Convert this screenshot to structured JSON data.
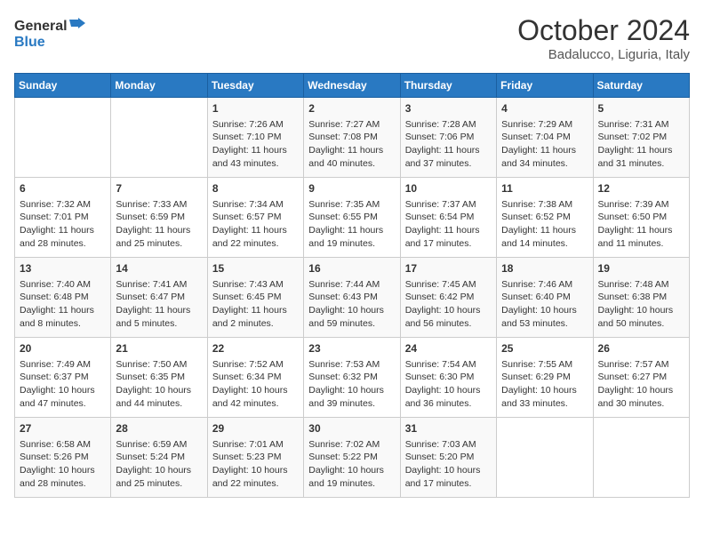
{
  "header": {
    "logo_line1": "General",
    "logo_line2": "Blue",
    "month": "October 2024",
    "location": "Badalucco, Liguria, Italy"
  },
  "days_of_week": [
    "Sunday",
    "Monday",
    "Tuesday",
    "Wednesday",
    "Thursday",
    "Friday",
    "Saturday"
  ],
  "weeks": [
    [
      {
        "day": "",
        "sunrise": "",
        "sunset": "",
        "daylight": ""
      },
      {
        "day": "",
        "sunrise": "",
        "sunset": "",
        "daylight": ""
      },
      {
        "day": "1",
        "sunrise": "Sunrise: 7:26 AM",
        "sunset": "Sunset: 7:10 PM",
        "daylight": "Daylight: 11 hours and 43 minutes."
      },
      {
        "day": "2",
        "sunrise": "Sunrise: 7:27 AM",
        "sunset": "Sunset: 7:08 PM",
        "daylight": "Daylight: 11 hours and 40 minutes."
      },
      {
        "day": "3",
        "sunrise": "Sunrise: 7:28 AM",
        "sunset": "Sunset: 7:06 PM",
        "daylight": "Daylight: 11 hours and 37 minutes."
      },
      {
        "day": "4",
        "sunrise": "Sunrise: 7:29 AM",
        "sunset": "Sunset: 7:04 PM",
        "daylight": "Daylight: 11 hours and 34 minutes."
      },
      {
        "day": "5",
        "sunrise": "Sunrise: 7:31 AM",
        "sunset": "Sunset: 7:02 PM",
        "daylight": "Daylight: 11 hours and 31 minutes."
      }
    ],
    [
      {
        "day": "6",
        "sunrise": "Sunrise: 7:32 AM",
        "sunset": "Sunset: 7:01 PM",
        "daylight": "Daylight: 11 hours and 28 minutes."
      },
      {
        "day": "7",
        "sunrise": "Sunrise: 7:33 AM",
        "sunset": "Sunset: 6:59 PM",
        "daylight": "Daylight: 11 hours and 25 minutes."
      },
      {
        "day": "8",
        "sunrise": "Sunrise: 7:34 AM",
        "sunset": "Sunset: 6:57 PM",
        "daylight": "Daylight: 11 hours and 22 minutes."
      },
      {
        "day": "9",
        "sunrise": "Sunrise: 7:35 AM",
        "sunset": "Sunset: 6:55 PM",
        "daylight": "Daylight: 11 hours and 19 minutes."
      },
      {
        "day": "10",
        "sunrise": "Sunrise: 7:37 AM",
        "sunset": "Sunset: 6:54 PM",
        "daylight": "Daylight: 11 hours and 17 minutes."
      },
      {
        "day": "11",
        "sunrise": "Sunrise: 7:38 AM",
        "sunset": "Sunset: 6:52 PM",
        "daylight": "Daylight: 11 hours and 14 minutes."
      },
      {
        "day": "12",
        "sunrise": "Sunrise: 7:39 AM",
        "sunset": "Sunset: 6:50 PM",
        "daylight": "Daylight: 11 hours and 11 minutes."
      }
    ],
    [
      {
        "day": "13",
        "sunrise": "Sunrise: 7:40 AM",
        "sunset": "Sunset: 6:48 PM",
        "daylight": "Daylight: 11 hours and 8 minutes."
      },
      {
        "day": "14",
        "sunrise": "Sunrise: 7:41 AM",
        "sunset": "Sunset: 6:47 PM",
        "daylight": "Daylight: 11 hours and 5 minutes."
      },
      {
        "day": "15",
        "sunrise": "Sunrise: 7:43 AM",
        "sunset": "Sunset: 6:45 PM",
        "daylight": "Daylight: 11 hours and 2 minutes."
      },
      {
        "day": "16",
        "sunrise": "Sunrise: 7:44 AM",
        "sunset": "Sunset: 6:43 PM",
        "daylight": "Daylight: 10 hours and 59 minutes."
      },
      {
        "day": "17",
        "sunrise": "Sunrise: 7:45 AM",
        "sunset": "Sunset: 6:42 PM",
        "daylight": "Daylight: 10 hours and 56 minutes."
      },
      {
        "day": "18",
        "sunrise": "Sunrise: 7:46 AM",
        "sunset": "Sunset: 6:40 PM",
        "daylight": "Daylight: 10 hours and 53 minutes."
      },
      {
        "day": "19",
        "sunrise": "Sunrise: 7:48 AM",
        "sunset": "Sunset: 6:38 PM",
        "daylight": "Daylight: 10 hours and 50 minutes."
      }
    ],
    [
      {
        "day": "20",
        "sunrise": "Sunrise: 7:49 AM",
        "sunset": "Sunset: 6:37 PM",
        "daylight": "Daylight: 10 hours and 47 minutes."
      },
      {
        "day": "21",
        "sunrise": "Sunrise: 7:50 AM",
        "sunset": "Sunset: 6:35 PM",
        "daylight": "Daylight: 10 hours and 44 minutes."
      },
      {
        "day": "22",
        "sunrise": "Sunrise: 7:52 AM",
        "sunset": "Sunset: 6:34 PM",
        "daylight": "Daylight: 10 hours and 42 minutes."
      },
      {
        "day": "23",
        "sunrise": "Sunrise: 7:53 AM",
        "sunset": "Sunset: 6:32 PM",
        "daylight": "Daylight: 10 hours and 39 minutes."
      },
      {
        "day": "24",
        "sunrise": "Sunrise: 7:54 AM",
        "sunset": "Sunset: 6:30 PM",
        "daylight": "Daylight: 10 hours and 36 minutes."
      },
      {
        "day": "25",
        "sunrise": "Sunrise: 7:55 AM",
        "sunset": "Sunset: 6:29 PM",
        "daylight": "Daylight: 10 hours and 33 minutes."
      },
      {
        "day": "26",
        "sunrise": "Sunrise: 7:57 AM",
        "sunset": "Sunset: 6:27 PM",
        "daylight": "Daylight: 10 hours and 30 minutes."
      }
    ],
    [
      {
        "day": "27",
        "sunrise": "Sunrise: 6:58 AM",
        "sunset": "Sunset: 5:26 PM",
        "daylight": "Daylight: 10 hours and 28 minutes."
      },
      {
        "day": "28",
        "sunrise": "Sunrise: 6:59 AM",
        "sunset": "Sunset: 5:24 PM",
        "daylight": "Daylight: 10 hours and 25 minutes."
      },
      {
        "day": "29",
        "sunrise": "Sunrise: 7:01 AM",
        "sunset": "Sunset: 5:23 PM",
        "daylight": "Daylight: 10 hours and 22 minutes."
      },
      {
        "day": "30",
        "sunrise": "Sunrise: 7:02 AM",
        "sunset": "Sunset: 5:22 PM",
        "daylight": "Daylight: 10 hours and 19 minutes."
      },
      {
        "day": "31",
        "sunrise": "Sunrise: 7:03 AM",
        "sunset": "Sunset: 5:20 PM",
        "daylight": "Daylight: 10 hours and 17 minutes."
      },
      {
        "day": "",
        "sunrise": "",
        "sunset": "",
        "daylight": ""
      },
      {
        "day": "",
        "sunrise": "",
        "sunset": "",
        "daylight": ""
      }
    ]
  ]
}
